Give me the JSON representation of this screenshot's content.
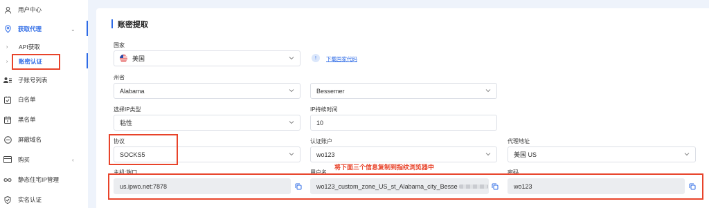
{
  "sidebar": {
    "items": [
      {
        "label": "用户中心",
        "icon": "user-icon"
      },
      {
        "label": "获取代理",
        "icon": "location-pin-icon"
      },
      {
        "label": "API获取"
      },
      {
        "label": "账密认证"
      },
      {
        "label": "子账号列表",
        "icon": "user-list-icon"
      },
      {
        "label": "白名单",
        "icon": "clipboard-check-icon"
      },
      {
        "label": "黑名单",
        "icon": "calendar-icon"
      },
      {
        "label": "屏蔽域名",
        "icon": "minus-circle-icon"
      },
      {
        "label": "购买",
        "icon": "card-icon"
      },
      {
        "label": "静态住宅IP管理",
        "icon": "infinity-icon"
      },
      {
        "label": "实名认证",
        "icon": "shield-icon"
      }
    ]
  },
  "page": {
    "title": "账密提取"
  },
  "form": {
    "country_label": "国家",
    "country_value": "美国",
    "download_link": "下载国家代码",
    "info_badge": "!",
    "state_label": "州省",
    "state_value": "Alabama",
    "city_value": "Bessemer",
    "ip_type_label": "选择IP类型",
    "ip_type_value": "粘性",
    "duration_label": "IP持续时间",
    "duration_value": "10",
    "protocol_label": "协议",
    "protocol_value": "SOCKS5",
    "account_label": "认证账户",
    "account_value": "wo123",
    "proxy_addr_label": "代理地址",
    "proxy_addr_value": "美国 US",
    "host_label": "主机:端口",
    "host_value": "us.ipwo.net:7878",
    "username_label": "用户名",
    "username_value": "wo123_custom_zone_US_st_Alabama_city_Besse",
    "password_label": "密码",
    "password_value": "wo123"
  },
  "annotation": "将下面三个信息复制到指纹浏览器中",
  "colors": {
    "accent": "#2e6be6",
    "highlight": "#e8432a"
  }
}
